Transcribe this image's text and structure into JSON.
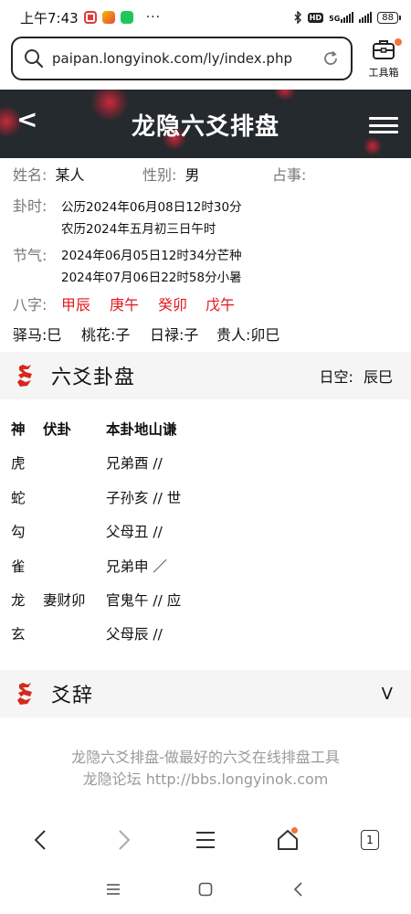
{
  "status_bar": {
    "time": "上午7:43",
    "dots": "···",
    "net_top": "5G",
    "net_bottom": "HD",
    "battery": "88"
  },
  "browser": {
    "url": "paipan.longyinok.com/ly/index.php",
    "toolbox_label": "工具箱"
  },
  "header": {
    "back": "<",
    "title": "龙隐六爻排盘"
  },
  "info": {
    "name_label": "姓名:",
    "name_value": "某人",
    "gender_label": "性别:",
    "gender_value": "男",
    "matter_label": "占事:",
    "time_label": "卦时:",
    "time_solar": "公历2024年06月08日12时30分",
    "time_lunar": "农历2024年五月初三日午时",
    "term_label": "节气:",
    "term_1": "2024年06月05日12时34分芒种",
    "term_2": "2024年07月06日22时58分小暑",
    "bazi_label": "八字:",
    "bazi": [
      "甲辰",
      "庚午",
      "癸卯",
      "戊午"
    ],
    "shensha": [
      "驿马:巳",
      "桃花:子",
      "日禄:子",
      "贵人:卯巳"
    ]
  },
  "gua_section": {
    "title": "六爻卦盘",
    "kong_label": "日空:",
    "kong_value": "辰巳",
    "headers": {
      "shen": "神",
      "fu": "伏卦",
      "ben": "本卦地山谦"
    },
    "rows": [
      {
        "shen": "虎",
        "fu": "",
        "ben": "兄弟酉 //"
      },
      {
        "shen": "蛇",
        "fu": "",
        "ben": "子孙亥 // 世"
      },
      {
        "shen": "勾",
        "fu": "",
        "ben": "父母丑 //"
      },
      {
        "shen": "雀",
        "fu": "",
        "ben": "兄弟申 ／"
      },
      {
        "shen": "龙",
        "fu": "妻财卯",
        "ben": "官鬼午 // 应"
      },
      {
        "shen": "玄",
        "fu": "",
        "ben": "父母辰 //"
      }
    ]
  },
  "yaoci_section": {
    "title": "爻辞",
    "toggle": "V"
  },
  "footer": {
    "line1": "龙隐六爻排盘-做最好的六爻在线排盘工具",
    "line2": "龙隐论坛 http://bbs.longyinok.com"
  },
  "bottom_nav": {
    "tab_count": "1"
  },
  "colors": {
    "accent_red": "#e3171c",
    "header_bg": "#242a2e",
    "notification_orange": "#f4743b"
  }
}
